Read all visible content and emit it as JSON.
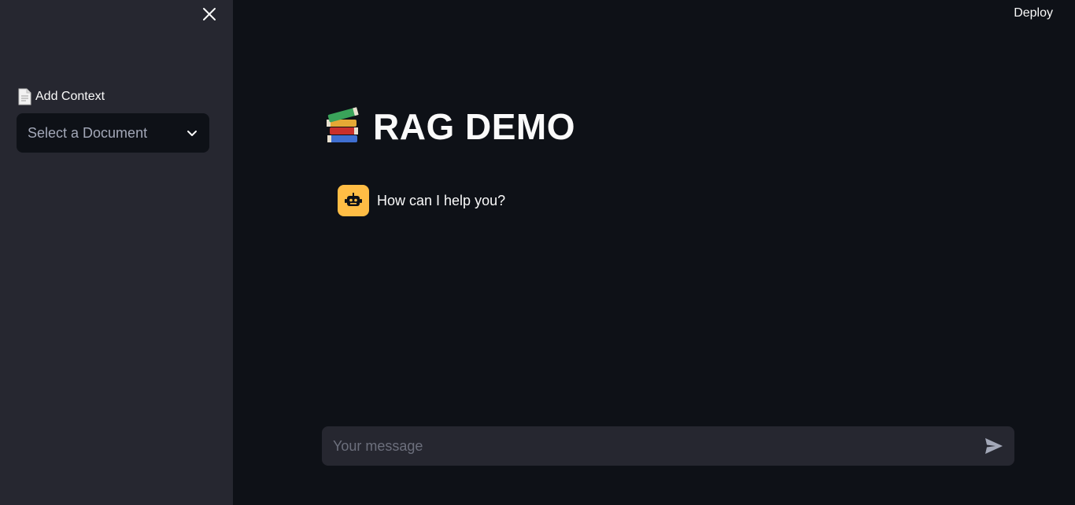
{
  "header": {
    "deploy_label": "Deploy"
  },
  "sidebar": {
    "close_icon": "close-icon",
    "context_label": "Add Context",
    "context_icon": "document-icon",
    "select": {
      "value": "Select a Document",
      "icon": "chevron-down-icon"
    }
  },
  "main": {
    "title_icon": "books-icon",
    "title": "RAG DEMO",
    "messages": [
      {
        "role": "assistant",
        "avatar_icon": "robot-icon",
        "text": "How can I help you?"
      }
    ],
    "chat_input": {
      "placeholder": "Your message",
      "value": "",
      "send_icon": "send-icon"
    }
  },
  "colors": {
    "background": "#0e1117",
    "sidebar": "#262730",
    "text": "#fafafa",
    "avatar_bg": "#ffbd45",
    "muted": "#a3a8b8"
  }
}
